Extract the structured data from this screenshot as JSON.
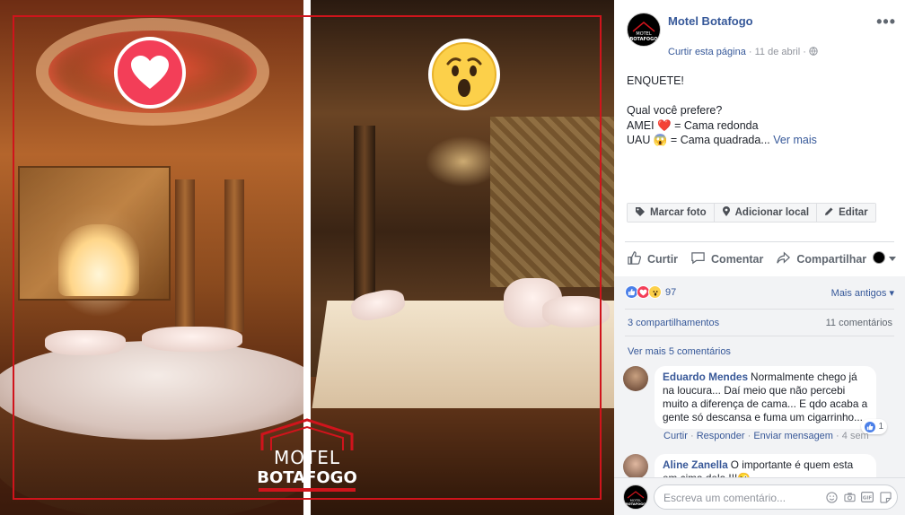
{
  "photo": {
    "logo_line1": "MOTEL",
    "logo_line2": "BOTAFOGO",
    "left_reaction": "love-icon",
    "right_reaction": "wow-icon"
  },
  "post": {
    "page_name": "Motel Botafogo",
    "avatar_text_1": "MOTEL",
    "avatar_text_2": "BOTAFOGO",
    "like_page": "Curtir esta página",
    "dot": "·",
    "date": "11 de abril",
    "dot2": "·",
    "audience_icon": "globe-icon",
    "more_icon": "•••",
    "text_line1": "ENQUETE!",
    "text_line2": "Qual você prefere?",
    "text_amei": "AMEI ",
    "text_amei_emoji": "❤️",
    "text_amei_rest": " = Cama redonda",
    "text_uau": "UAU ",
    "text_uau_emoji": "😱",
    "text_uau_rest": " = Cama quadrada...",
    "see_more": " Ver mais"
  },
  "photo_actions": {
    "tag": "Marcar foto",
    "location": "Adicionar local",
    "edit": "Editar"
  },
  "actions": {
    "like": "Curtir",
    "comment": "Comentar",
    "share": "Compartilhar"
  },
  "feedback": {
    "reaction_count": "97",
    "order": "Mais antigos ▾",
    "shares": "3 compartilhamentos",
    "comments": "11 comentários",
    "view_more": "Ver mais 5 comentários"
  },
  "comments": [
    {
      "author": "Eduardo Mendes",
      "text": "Normalmente chego já na loucura... Daí meio que não percebi muito a diferença de cama... E qdo acaba a gente só descansa e fuma um cigarrinho...",
      "likes": "1",
      "actions": {
        "like": "Curtir",
        "reply": "Responder",
        "message": "Enviar mensagem",
        "time": "4 sem"
      }
    },
    {
      "author": "Aline Zanella",
      "text": "O importante é quem esta em cima dela !!!😜"
    }
  ],
  "composer": {
    "placeholder": "Escreva um comentário..."
  },
  "colors": {
    "fb_blue": "#365899",
    "frame_red": "#d0141c",
    "love": "#f33e58",
    "wow": "#fcd04a"
  }
}
